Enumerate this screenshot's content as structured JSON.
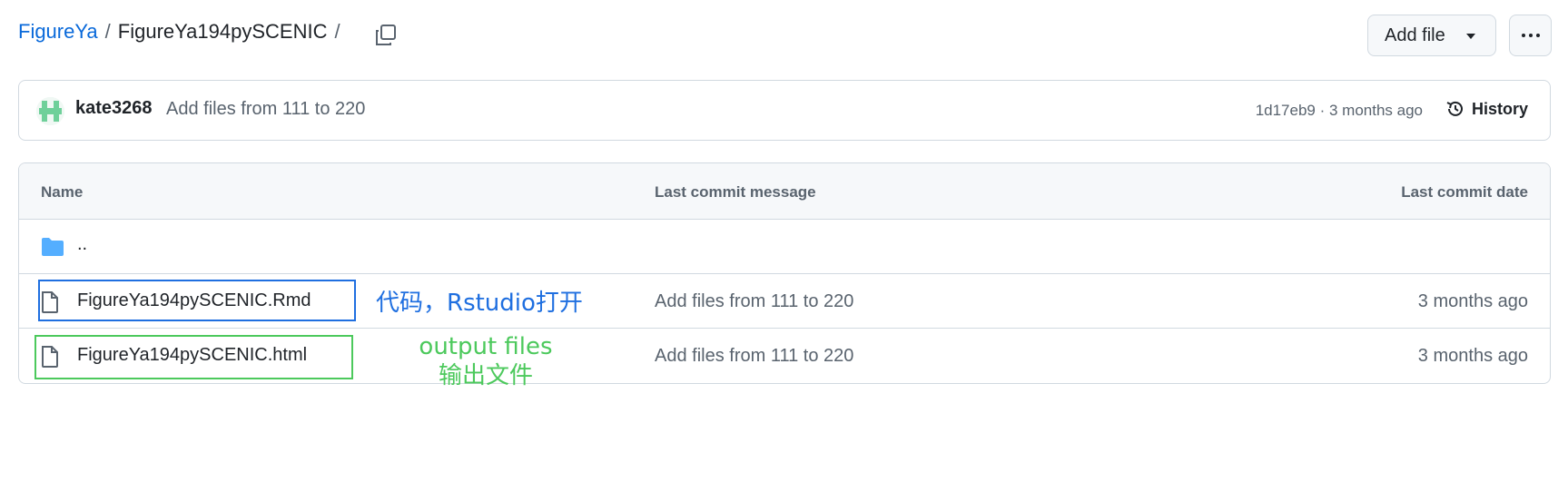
{
  "breadcrumb": {
    "owner": "FigureYa",
    "sep1": "/",
    "repo": "FigureYa194pySCENIC",
    "sep2": "/"
  },
  "header": {
    "add_file_label": "Add file",
    "more_icon": "kebab-horizontal-icon",
    "copy_icon": "copy-icon"
  },
  "commit": {
    "author": "kate3268",
    "message": "Add files from 111 to 220",
    "meta": "1d17eb9 · 3 months ago",
    "history_label": "History"
  },
  "table": {
    "headers": [
      "Name",
      "Last commit message",
      "Last commit date"
    ],
    "parent_label": "..",
    "rows": [
      {
        "name": "FigureYa194pySCENIC.Rmd",
        "message": "Add files from 111 to 220",
        "date": "3 months ago",
        "icon": "file-icon"
      },
      {
        "name": "FigureYa194pySCENIC.html",
        "message": "Add files from 111 to 220",
        "date": "3 months ago",
        "icon": "file-icon"
      }
    ]
  },
  "annotations": {
    "rmd_note": "代码，Rstudio打开",
    "html_note_line1": "output files",
    "html_note_line2": "输出文件",
    "blue": "#1f6fe0",
    "green": "#4cc95c"
  }
}
